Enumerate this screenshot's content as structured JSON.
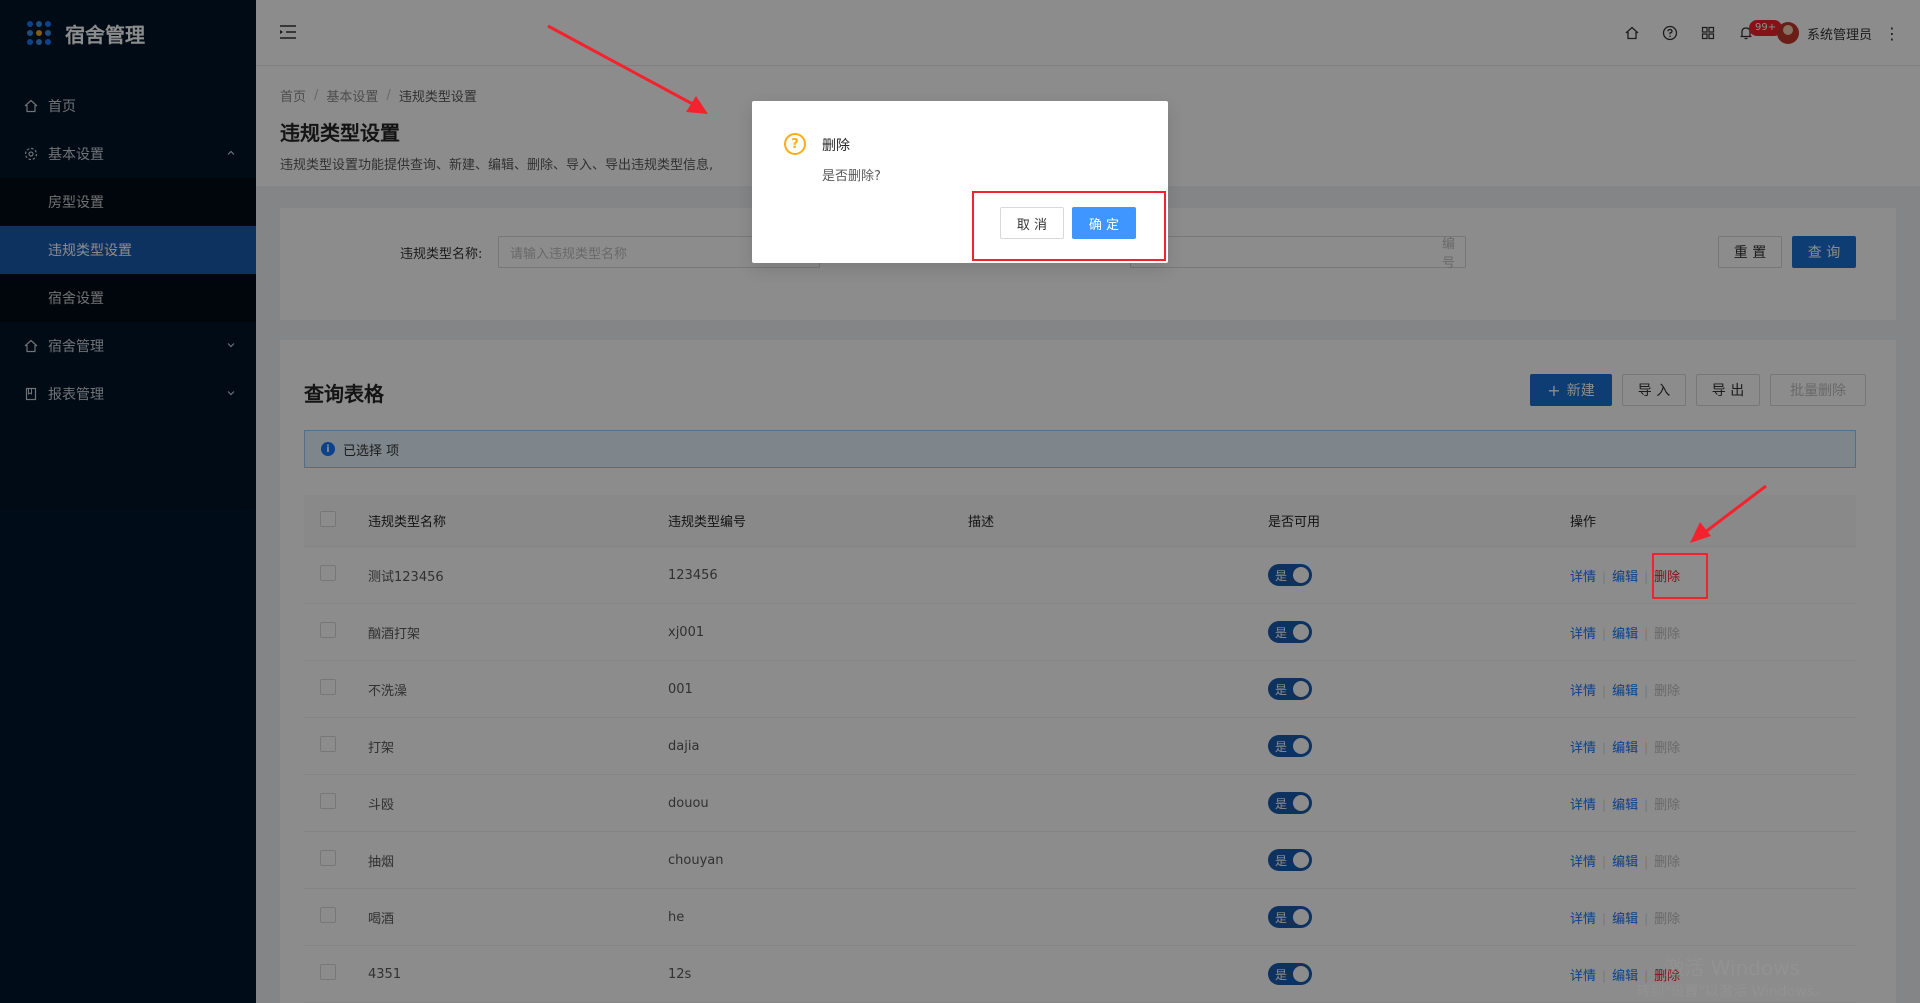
{
  "app": {
    "title": "宿舍管理"
  },
  "sidebar": {
    "items": [
      {
        "label": "首页",
        "icon": "home-icon"
      },
      {
        "label": "基本设置",
        "icon": "gear-icon"
      },
      {
        "label": "宿舍管理",
        "icon": "home-icon"
      },
      {
        "label": "报表管理",
        "icon": "report-icon"
      }
    ],
    "submenu": [
      {
        "label": "房型设置"
      },
      {
        "label": "违规类型设置"
      },
      {
        "label": "宿舍设置"
      }
    ]
  },
  "header": {
    "notification_badge": "99+",
    "user_name": "系统管理员"
  },
  "breadcrumb": [
    "首页",
    "基本设置",
    "违规类型设置"
  ],
  "page": {
    "title": "违规类型设置",
    "description": "违规类型设置功能提供查询、新建、编辑、删除、导入、导出违规类型信息,"
  },
  "search": {
    "name_label": "违规类型名称:",
    "name_placeholder": "请输入违规类型名称",
    "code_placeholder": "编号",
    "reset_label": "重 置",
    "query_label": "查 询"
  },
  "table": {
    "title": "查询表格",
    "new_label": "新建",
    "import_label": "导 入",
    "export_label": "导 出",
    "batch_delete_label": "批量删除",
    "selected_text": "已选择 项",
    "columns": [
      "违规类型名称",
      "违规类型编号",
      "描述",
      "是否可用",
      "操作"
    ],
    "rows": [
      {
        "name": "测试123456",
        "code": "123456",
        "desc": "",
        "available": "是"
      },
      {
        "name": "酗酒打架",
        "code": "xj001",
        "desc": "",
        "available": "是"
      },
      {
        "name": "不洗澡",
        "code": "001",
        "desc": "",
        "available": "是"
      },
      {
        "name": "打架",
        "code": "dajia",
        "desc": "",
        "available": "是"
      },
      {
        "name": "斗殴",
        "code": "douou",
        "desc": "",
        "available": "是"
      },
      {
        "name": "抽烟",
        "code": "chouyan",
        "desc": "",
        "available": "是"
      },
      {
        "name": "喝酒",
        "code": "he",
        "desc": "",
        "available": "是"
      },
      {
        "name": "4351",
        "code": "12s",
        "desc": "",
        "available": "是"
      }
    ],
    "op_detail": "详情",
    "op_edit": "编辑",
    "op_delete": "删除"
  },
  "modal": {
    "title": "删除",
    "content": "是否删除?",
    "cancel_label": "取 消",
    "ok_label": "确 定"
  },
  "watermark": {
    "line1": "激活 Windows",
    "line2": "转到\"设置\"以激活 Windows。"
  },
  "colors": {
    "sidebar_bg": "#001529",
    "primary": "#1a6fd3",
    "danger": "#f5222d",
    "warning": "#faad14"
  }
}
